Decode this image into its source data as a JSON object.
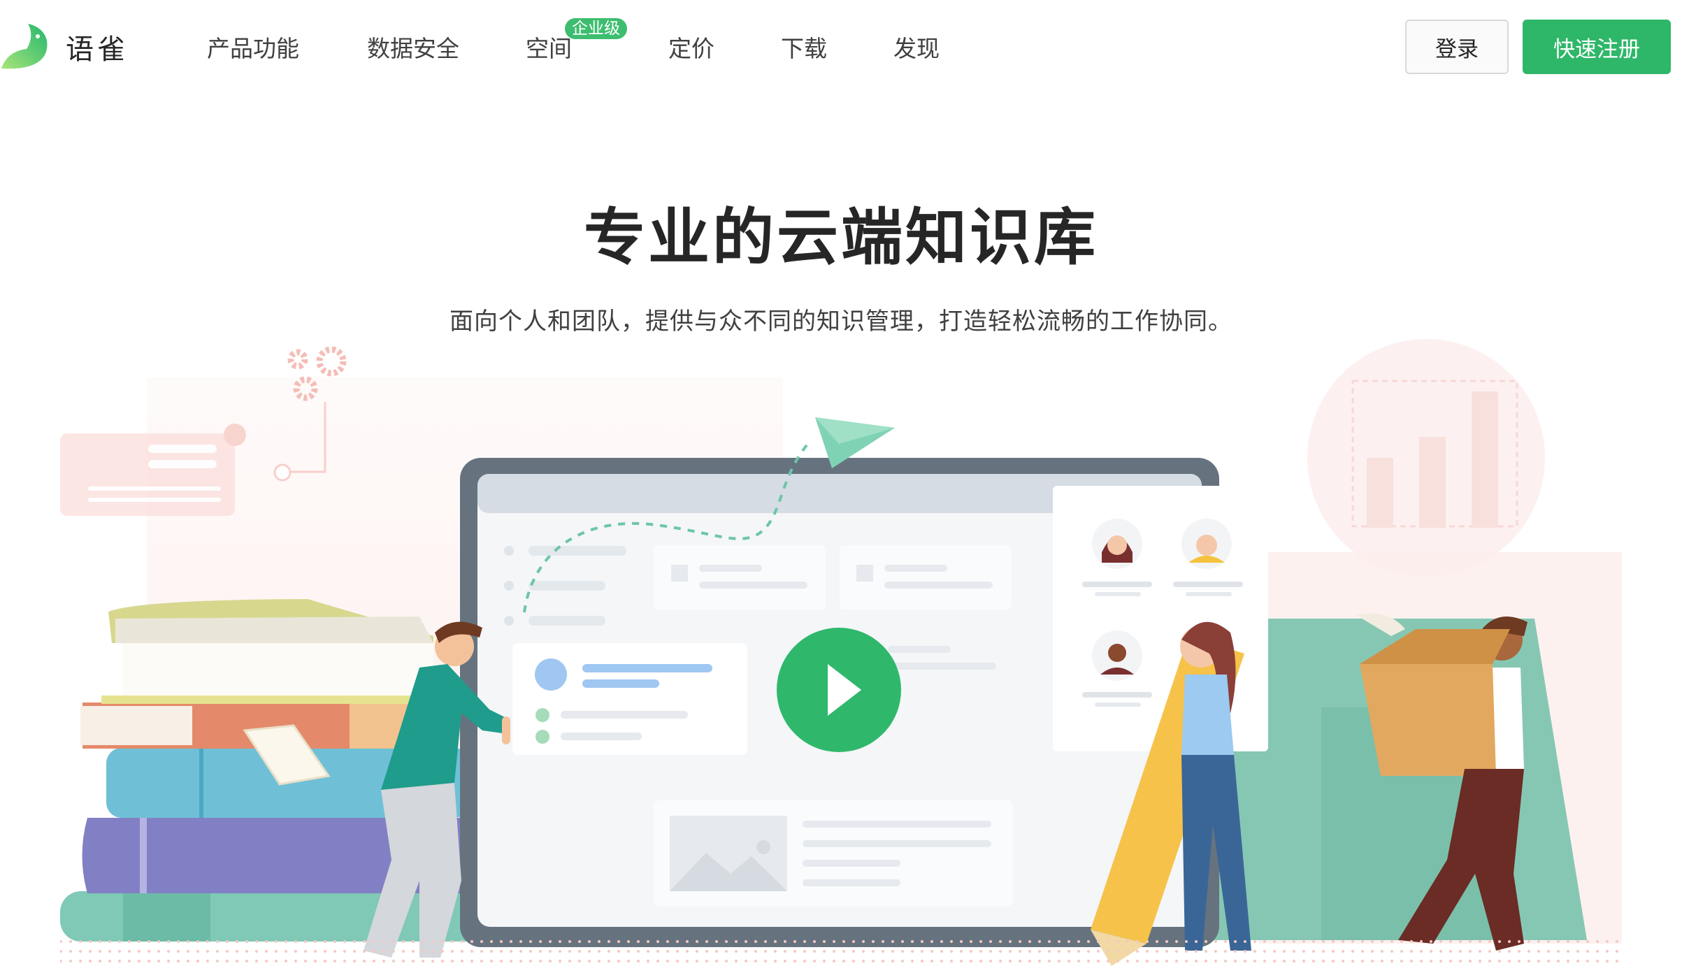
{
  "brand": {
    "name": "语雀"
  },
  "nav": {
    "items": [
      {
        "label": "产品功能"
      },
      {
        "label": "数据安全"
      },
      {
        "label": "空间",
        "badge": "企业级"
      },
      {
        "label": "定价"
      },
      {
        "label": "下载"
      },
      {
        "label": "发现"
      }
    ]
  },
  "auth": {
    "login_label": "登录",
    "register_label": "快速注册"
  },
  "hero": {
    "title": "专业的云端知识库",
    "subtitle": "面向个人和团队，提供与众不同的知识管理，打造轻松流畅的工作协同。"
  },
  "colors": {
    "brand_green": "#2fb769",
    "badge_green": "#3dbd6f",
    "play_green": "#2eb66a",
    "teal": "#7dc6b2"
  },
  "icons": {
    "logo": "yuque-bird-icon",
    "play": "play-icon",
    "gear": "gear-icon",
    "paper_plane": "paper-plane-icon"
  }
}
